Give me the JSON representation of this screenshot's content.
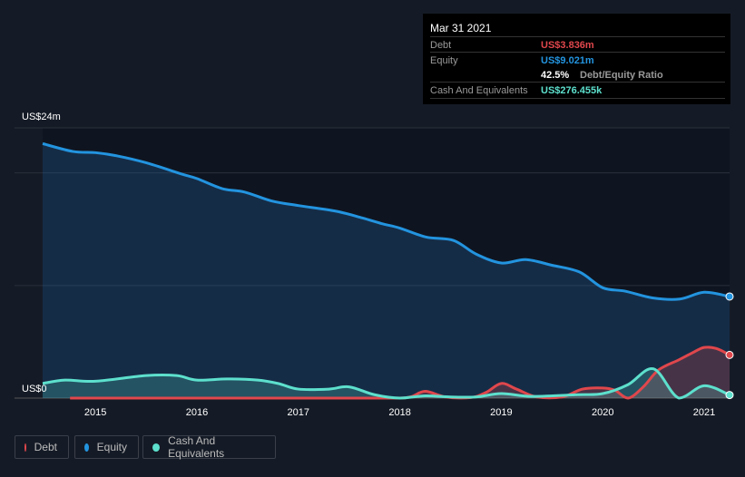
{
  "chart_data": {
    "type": "area",
    "y_unit_label_top": "US$24m",
    "y_unit_label_bottom": "US$0",
    "ylim": [
      0,
      24
    ],
    "xlim": [
      2014.48,
      2021.25
    ],
    "x_ticks": [
      "2015",
      "2016",
      "2017",
      "2018",
      "2019",
      "2020",
      "2021"
    ],
    "grid": true,
    "legend_placement": "bottom-left",
    "series": [
      {
        "name": "Debt",
        "color": "#e0474c",
        "x": [
          2014.75,
          2015,
          2016,
          2017,
          2017.9,
          2018.1,
          2018.25,
          2018.45,
          2018.7,
          2018.85,
          2019,
          2019.15,
          2019.35,
          2019.6,
          2019.8,
          2020,
          2020.12,
          2020.25,
          2020.4,
          2020.55,
          2020.75,
          2020.9,
          2021,
          2021.12,
          2021.25
        ],
        "values": [
          0,
          0,
          0,
          0,
          0,
          0.1,
          0.6,
          0.1,
          0.05,
          0.5,
          1.3,
          0.8,
          0.1,
          0.1,
          0.8,
          0.9,
          0.7,
          0,
          1.0,
          2.5,
          3.4,
          4.1,
          4.5,
          4.4,
          3.836
        ]
      },
      {
        "name": "Equity",
        "color": "#2394df",
        "x": [
          2014.48,
          2014.78,
          2015,
          2015.22,
          2015.5,
          2015.85,
          2016,
          2016.25,
          2016.47,
          2016.74,
          2017,
          2017.37,
          2017.63,
          2017.82,
          2018,
          2018.26,
          2018.53,
          2018.75,
          2019,
          2019.24,
          2019.5,
          2019.77,
          2020,
          2020.22,
          2020.49,
          2020.76,
          2021,
          2021.25
        ],
        "values": [
          22.6,
          21.9,
          21.8,
          21.5,
          20.9,
          19.9,
          19.5,
          18.6,
          18.3,
          17.5,
          17.1,
          16.6,
          16.0,
          15.5,
          15.1,
          14.3,
          14.0,
          12.8,
          12.0,
          12.3,
          11.8,
          11.2,
          9.8,
          9.5,
          8.9,
          8.8,
          9.4,
          9.021
        ]
      },
      {
        "name": "Cash And Equivalents",
        "color": "#5de0cd",
        "x": [
          2014.48,
          2014.7,
          2015,
          2015.5,
          2015.8,
          2016,
          2016.3,
          2016.6,
          2016.8,
          2017,
          2017.3,
          2017.5,
          2017.75,
          2018,
          2018.25,
          2018.5,
          2018.75,
          2019,
          2019.3,
          2019.75,
          2020,
          2020.25,
          2020.5,
          2020.75,
          2021,
          2021.25
        ],
        "values": [
          1.3,
          1.6,
          1.5,
          2.0,
          2.0,
          1.6,
          1.7,
          1.6,
          1.3,
          0.8,
          0.8,
          1.0,
          0.3,
          0,
          0.2,
          0.1,
          0.1,
          0.4,
          0.15,
          0.3,
          0.4,
          1.2,
          2.6,
          0,
          1.1,
          0.276
        ]
      }
    ]
  },
  "tooltip": {
    "date": "Mar 31 2021",
    "debt_label": "Debt",
    "debt_value": "US$3.836m",
    "equity_label": "Equity",
    "equity_value": "US$9.021m",
    "ratio_value": "42.5%",
    "ratio_label": "Debt/Equity Ratio",
    "cash_label": "Cash And Equivalents",
    "cash_value": "US$276.455k"
  },
  "legend": {
    "debt": "Debt",
    "equity": "Equity",
    "cash": "Cash And Equivalents"
  },
  "colors": {
    "debt": "#e0474c",
    "equity": "#2394df",
    "cash": "#5de0cd",
    "background": "#151b26"
  }
}
